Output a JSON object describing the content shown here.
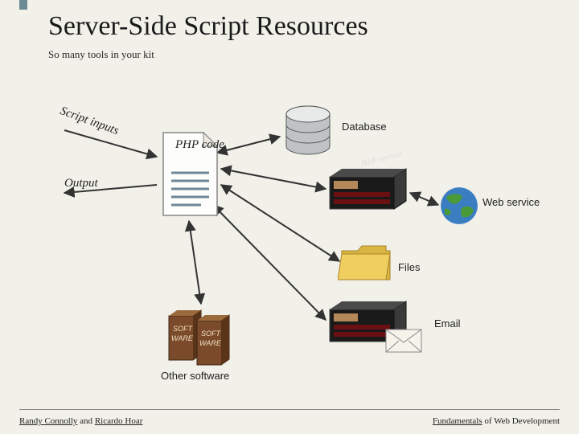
{
  "title": "Server-Side Script Resources",
  "subtitle": "So many tools in your kit",
  "labels": {
    "script_inputs": "Script inputs",
    "output": "Output",
    "php_code": "PHP code",
    "database": "Database",
    "web_server": "Web server",
    "web_service": "Web service",
    "files": "Files",
    "email": "Email",
    "other_software": "Other software"
  },
  "footer": {
    "author1": "Randy Connolly",
    "connector": " and ",
    "author2": "Ricardo Hoar",
    "book_part1": "Fundamentals",
    "book_part2": " of Web Development"
  }
}
